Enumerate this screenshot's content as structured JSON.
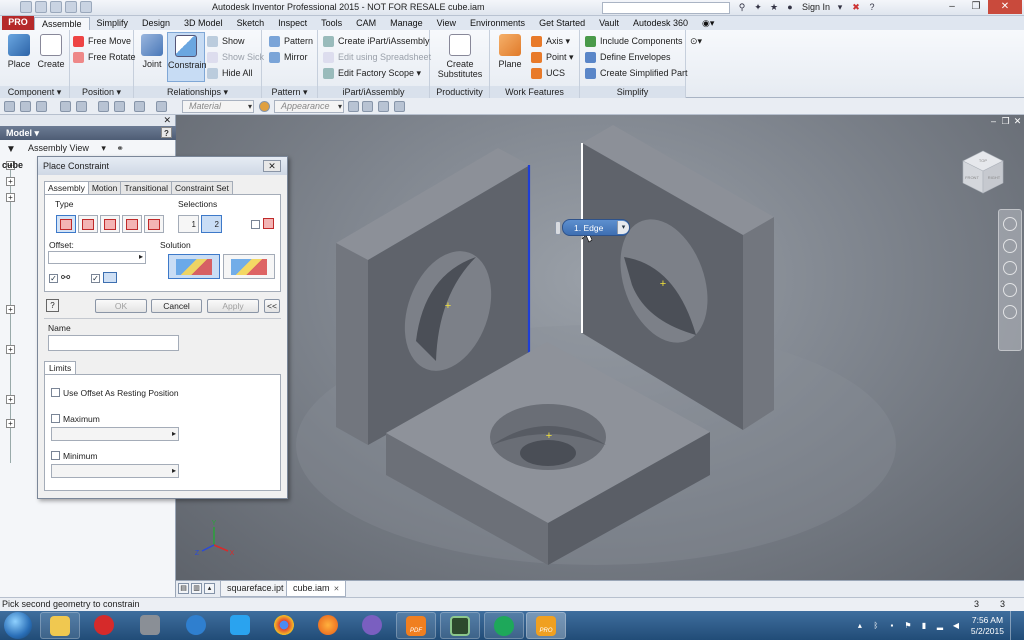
{
  "window": {
    "title": "Autodesk Inventor Professional 2015 - NOT FOR RESALE    cube.iam",
    "search_placeholder": "",
    "sign_in": "Sign In",
    "help": "?"
  },
  "ribbon_tabs": [
    "Assemble",
    "Simplify",
    "Design",
    "3D Model",
    "Sketch",
    "Inspect",
    "Tools",
    "CAM",
    "Manage",
    "View",
    "Environments",
    "Get Started",
    "Vault",
    "Autodesk 360"
  ],
  "file_tab": "PRO",
  "ribbon": {
    "component": {
      "label": "Component ▾",
      "place": "Place",
      "create": "Create"
    },
    "position": {
      "label": "Position ▾",
      "free_move": "Free Move",
      "free_rotate": "Free Rotate"
    },
    "relationships": {
      "label": "Relationships ▾",
      "joint": "Joint",
      "constrain": "Constrain",
      "show": "Show",
      "show_sick": "Show Sick",
      "hide_all": "Hide All"
    },
    "pattern": {
      "label": "Pattern ▾",
      "pattern": "Pattern",
      "mirror": "Mirror"
    },
    "ipart": {
      "label": "iPart/iAssembly",
      "create": "Create iPart/iAssembly",
      "edit_spreadsheet": "Edit using Spreadsheet",
      "edit_factory": "Edit Factory Scope ▾"
    },
    "productivity": {
      "label": "Productivity",
      "create_substitutes": "Create Substitutes"
    },
    "work_features": {
      "label": "Work Features",
      "plane": "Plane",
      "axis": "Axis ▾",
      "point": "Point ▾",
      "ucs": "UCS"
    },
    "simplify": {
      "label": "Simplify",
      "include": "Include Components",
      "define": "Define Envelopes",
      "create_simplified": "Create Simplified Part"
    }
  },
  "toolbar2": {
    "material": "Material",
    "appearance": "Appearance"
  },
  "browser": {
    "title": "Model ▾",
    "help": "?",
    "view": "Assembly View",
    "root": "cube"
  },
  "dialog": {
    "title": "Place Constraint",
    "tabs": [
      "Assembly",
      "Motion",
      "Transitional",
      "Constraint Set"
    ],
    "type_label": "Type",
    "selections_label": "Selections",
    "sel1": "1",
    "sel2": "2",
    "offset_label": "Offset:",
    "solution_label": "Solution",
    "ok": "OK",
    "cancel": "Cancel",
    "apply": "Apply",
    "more": "<<",
    "help": "?",
    "name_label": "Name",
    "limits_tab": "Limits",
    "use_offset": "Use Offset As Resting Position",
    "maximum": "Maximum",
    "minimum": "Minimum"
  },
  "viewport": {
    "edge_chip": "1. Edge",
    "viewcube": {
      "top": "TOP",
      "front": "FRONT",
      "right": "RIGHT"
    },
    "triad": {
      "x": "X",
      "y": "Y",
      "z": "Z"
    }
  },
  "doc_tabs": [
    "squareface.ipt",
    "cube.iam"
  ],
  "status": {
    "text": "Pick second geometry to constrain",
    "n1": "3",
    "n2": "3"
  },
  "taskbar": {
    "time": "7:56 AM",
    "date": "5/2/2015",
    "pdf1": "PDF",
    "pdf2": "PRO"
  },
  "colors": {
    "accent": "#3e6fb2",
    "file_tab": "#b5292a",
    "edge_highlight": "#1f3fd6"
  }
}
